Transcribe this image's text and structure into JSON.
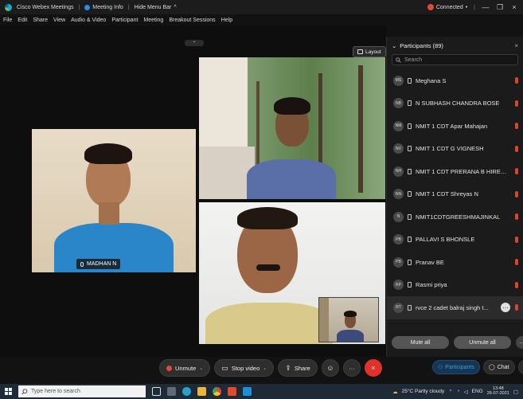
{
  "titlebar": {
    "app_title": "Cisco Webex Meetings",
    "meeting_info": "Meeting Info",
    "hide_menu": "Hide Menu Bar",
    "hide_menu_chevron": "^",
    "status": "Connected",
    "status_chevron": "•",
    "divider": "|",
    "minimize": "—",
    "restore": "❐",
    "close": "×"
  },
  "menu": {
    "items": [
      "File",
      "Edit",
      "Share",
      "View",
      "Audio & Video",
      "Participant",
      "Meeting",
      "Breakout Sessions",
      "Help"
    ]
  },
  "stage": {
    "layout_label": "Layout",
    "collapse_glyph": "⌃",
    "main_speaker_name": "MADHAN N"
  },
  "controls": {
    "unmute": "Unmute",
    "stop_video": "Stop video",
    "share": "Share",
    "more": "···",
    "end": "×",
    "participants": "Participants",
    "chat": "Chat",
    "extra": "···"
  },
  "participants_panel": {
    "title": "Participants (89)",
    "search_placeholder": "Search",
    "items": [
      {
        "initials": "MS",
        "name": "Meghana S"
      },
      {
        "initials": "NB",
        "name": "N SUBHASH CHANDRA BOSE"
      },
      {
        "initials": "NM",
        "name": "NMIT 1 CDT Apar Mahajan"
      },
      {
        "initials": "NV",
        "name": "NMIT 1 CDT G VIGNESH"
      },
      {
        "initials": "NH",
        "name": "NMIT 1 CDT PRERANA B HIREM..."
      },
      {
        "initials": "NN",
        "name": "NMIT 1 CDT Shreyas N"
      },
      {
        "initials": "N",
        "name": "NMIT1CDTGREESHMAJINKAL"
      },
      {
        "initials": "PB",
        "name": "PALLAVI S BHONSLE"
      },
      {
        "initials": "PB",
        "name": "Pranav BE"
      },
      {
        "initials": "RP",
        "name": "Rasmi priya"
      },
      {
        "initials": "RT",
        "name": "rvce 2 cadet balraj singh t..."
      }
    ],
    "mute_all": "Mute all",
    "unmute_all": "Unmute all",
    "more": "···"
  },
  "taskbar": {
    "search_placeholder": "Type here to search",
    "weather": "25°C  Partly cloudy",
    "language": "ENG",
    "time": "13:48",
    "date": "26-07-2021"
  },
  "colors": {
    "end_button": "#e0312b",
    "accent": "#3d9be9",
    "muted_icon": "#d9452f"
  }
}
